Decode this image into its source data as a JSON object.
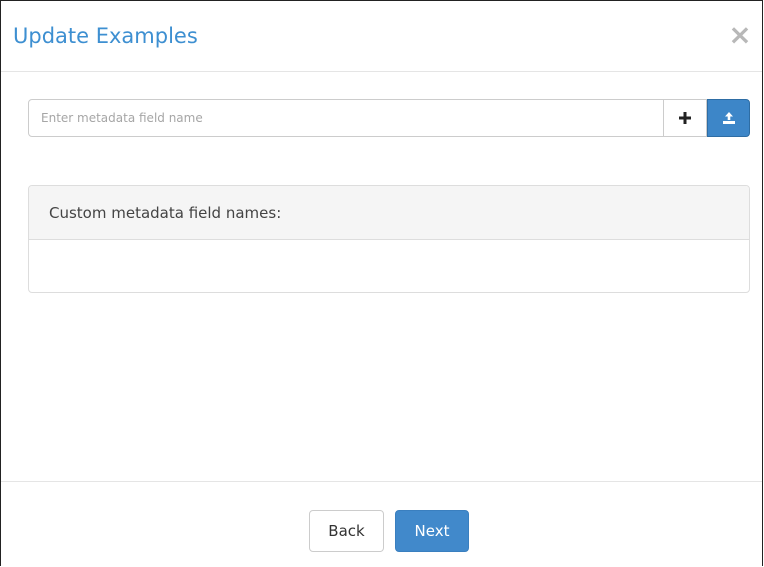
{
  "modal": {
    "title": "Update Examples",
    "close_label": "×"
  },
  "metadata_input": {
    "placeholder": "Enter metadata field name",
    "value": "",
    "add_icon": "plus-icon",
    "upload_icon": "upload-icon"
  },
  "panel": {
    "heading": "Custom metadata field names:",
    "items": []
  },
  "footer": {
    "back_label": "Back",
    "next_label": "Next"
  },
  "colors": {
    "title": "#3d8fd1",
    "primary": "#4189cb",
    "panel_heading_bg": "#f5f5f5"
  }
}
